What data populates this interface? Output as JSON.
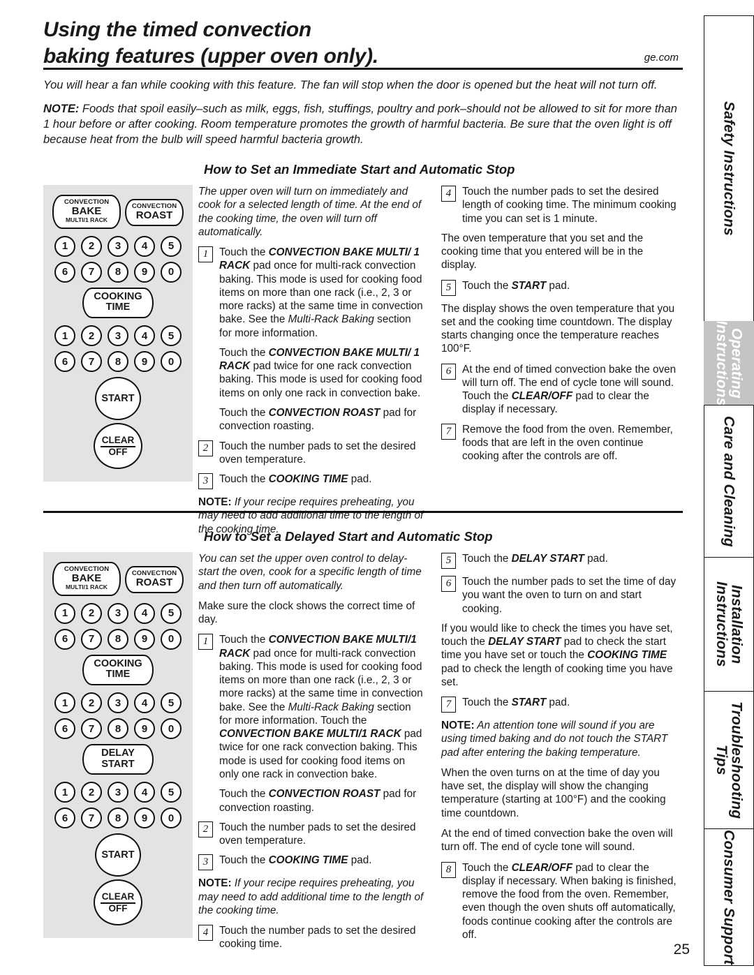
{
  "header": {
    "title_line1": "Using the timed convection",
    "title_line2": "baking features (upper oven only).",
    "website": "ge.com"
  },
  "intro": {
    "paragraph1": "You will hear a fan while cooking with this feature. The fan will stop when the door is opened but the heat will not turn off.",
    "note_label": "NOTE:",
    "note_text": " Foods that spoil easily–such as milk, eggs, fish, stuffings, poultry and pork–should not be allowed to sit for more than 1 hour before or after cooking. Room temperature promotes the growth of harmful bacteria. Be sure that the oven light is off because heat from the bulb will speed harmful bacteria growth."
  },
  "control_panel": {
    "convection_bake": {
      "line1": "CONVECTION",
      "line2": "BAKE",
      "line3": "MULTI/1 RACK"
    },
    "convection_roast": {
      "line1": "CONVECTION",
      "line2": "ROAST"
    },
    "cooking_time": {
      "line1": "COOKING",
      "line2": "TIME"
    },
    "delay_start": {
      "line1": "DELAY",
      "line2": "START"
    },
    "start": "START",
    "clear_off": {
      "top": "CLEAR",
      "bottom": "OFF"
    },
    "keys_row1": [
      "1",
      "2",
      "3",
      "4",
      "5"
    ],
    "keys_row2": [
      "6",
      "7",
      "8",
      "9",
      "0"
    ]
  },
  "section1": {
    "heading": "How to Set an Immediate Start and Automatic Stop",
    "lead": "The upper oven will turn on immediately and cook for a selected length of time. At the end of the cooking time, the oven will turn off automatically.",
    "step1_num": "1",
    "step1_a_pre": "Touch the ",
    "step1_a_bold": "CONVECTION BAKE MULTI/ 1 RACK",
    "step1_a_post": " pad once for multi-rack convection baking. This mode is used for cooking food items on more than one rack (i.e., 2, 3 or more racks) at the same time in convection bake. See the ",
    "step1_a_ital": "Multi-Rack Baking",
    "step1_a_tail": " section for more information.",
    "step1_b_pre": "Touch the ",
    "step1_b_bold": "CONVECTION BAKE MULTI/ 1 RACK",
    "step1_b_post": " pad twice for one rack convection baking. This mode is used for cooking food items on only one rack in convection bake.",
    "step1_c_pre": "Touch the ",
    "step1_c_bold": "CONVECTION ROAST",
    "step1_c_post": " pad for convection roasting.",
    "step2_num": "2",
    "step2_text": "Touch the number pads to set the desired oven temperature.",
    "step3_num": "3",
    "step3_pre": "Touch the ",
    "step3_bold": "COOKING TIME",
    "step3_post": " pad.",
    "note_label": "NOTE:",
    "note_text": " If your recipe requires preheating, you may need to add additional time to the length of the cooking time.",
    "step4_num": "4",
    "step4_text": "Touch the number pads to set the desired length of cooking time. The minimum cooking time you can set is 1 minute.",
    "para_display": "The oven temperature that you set and the cooking time that you entered will be in the display.",
    "step5_num": "5",
    "step5_pre": "Touch the ",
    "step5_bold": "START",
    "step5_post": " pad.",
    "para_countdown": "The display shows the oven temperature that you set and the cooking time countdown. The display starts changing once the temperature reaches 100°F.",
    "step6_num": "6",
    "step6_pre": "At the end of timed convection bake the oven will turn off. The end of cycle tone will sound. Touch the ",
    "step6_bold": "CLEAR/OFF",
    "step6_post": " pad to clear the display if necessary.",
    "step7_num": "7",
    "step7_text": "Remove the food from the oven. Remember, foods that are left in the oven continue cooking after the controls are off."
  },
  "section2": {
    "heading": "How to Set a Delayed Start and Automatic Stop",
    "lead": "You can set the upper oven control to delay-start the oven, cook for a specific length of time and then turn off automatically.",
    "para_clock": "Make sure the clock shows the correct time of day.",
    "step1_num": "1",
    "step1_a_pre": "Touch the ",
    "step1_a_bold": "CONVECTION BAKE MULTI/1 RACK",
    "step1_a_post": " pad once for multi-rack convection baking. This mode is used for cooking food items on more than one rack (i.e., 2, 3 or more racks) at the same time in convection bake. See the ",
    "step1_a_ital": "Multi-Rack Baking",
    "step1_a_tail": " section for more information. Touch the ",
    "step1_a_bold2": "CONVECTION BAKE MULTI/1 RACK",
    "step1_a_tail2": " pad twice for one rack convection baking. This mode is used for cooking food items on only one rack in convection bake.",
    "step1_c_pre": "Touch the ",
    "step1_c_bold": "CONVECTION ROAST",
    "step1_c_post": " pad for convection roasting.",
    "step2_num": "2",
    "step2_text": "Touch the number pads to set the desired oven temperature.",
    "step3_num": "3",
    "step3_pre": "Touch the ",
    "step3_bold": "COOKING TIME",
    "step3_post": " pad.",
    "note_label": "NOTE:",
    "note_text": " If your recipe requires preheating, you may need to add additional time to the length of the cooking time.",
    "step4_num": "4",
    "step4_text": "Touch the number pads to set the desired cooking time.",
    "step5_num": "5",
    "step5_pre": "Touch the ",
    "step5_bold": "DELAY START",
    "step5_post": " pad.",
    "step6_num": "6",
    "step6_text": "Touch the number pads to set the time of day you want the oven to turn on and start cooking.",
    "para_check_pre": "If you would like to check the times you have set, touch the ",
    "para_check_bold1": "DELAY START",
    "para_check_mid": " pad to check the start time you have set or touch the ",
    "para_check_bold2": "COOKING TIME",
    "para_check_post": " pad to check the length of cooking time you have set.",
    "step7_num": "7",
    "step7_pre": "Touch the ",
    "step7_bold": "START",
    "step7_post": " pad.",
    "note2_label": "NOTE:",
    "note2_text": " An attention tone will sound if you are using timed baking and do not touch the START pad after entering the baking temperature.",
    "para_turnson": "When the oven turns on at the time of day you have set, the display will show the changing temperature (starting at 100°F) and the cooking time countdown.",
    "para_end": "At the end of timed convection bake the oven will turn off. The end of cycle tone will sound.",
    "step8_num": "8",
    "step8_pre": "Touch the ",
    "step8_bold": "CLEAR/OFF",
    "step8_post": " pad to clear the display if necessary. When baking is finished, remove the food from the oven. Remember, even though the oven shuts off automatically, foods continue cooking after the controls are off."
  },
  "sidebar": {
    "tabs": [
      {
        "label": "Safety Instructions",
        "active": false
      },
      {
        "label": "Operating\nInstructions",
        "active": true
      },
      {
        "label": "Care and Cleaning",
        "active": false
      },
      {
        "label": "Installation\nInstructions",
        "active": false
      },
      {
        "label": "Troubleshooting\nTips",
        "active": false
      },
      {
        "label": "Consumer Support",
        "active": false
      }
    ]
  },
  "page_number": "25",
  "colors": {
    "panel_background": "#e3e3e3",
    "active_tab": "#c4c4c4",
    "text": "#1a1a1a"
  }
}
